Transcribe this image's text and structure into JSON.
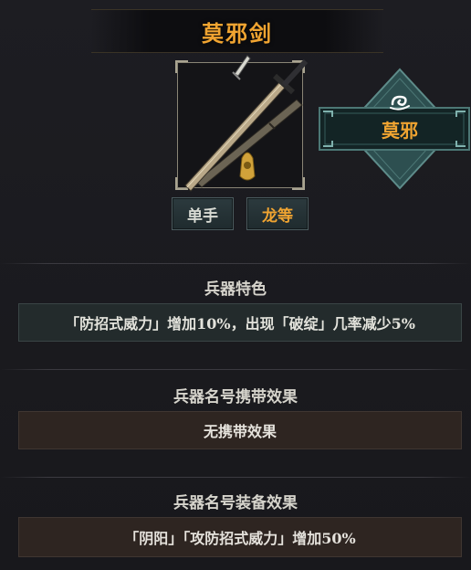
{
  "weapon": {
    "name": "莫邪剑",
    "hand_type": "单手",
    "grade": "龙等",
    "badge_name": "莫邪"
  },
  "sections": {
    "feature": {
      "title": "兵器特色",
      "text": "「防招式威力」增加10%，出现「破绽」几率减少5%"
    },
    "carry": {
      "title": "兵器名号携带效果",
      "text": "无携带效果"
    },
    "equip": {
      "title": "兵器名号装备效果",
      "text": "「阴阳」「攻防招式威力」增加50%"
    }
  },
  "colors": {
    "accent_orange": "#f0a431",
    "teal_panel": "#232b2c",
    "brown_panel": "#2e2521",
    "badge_teal": "#3f6b6a"
  },
  "icons": {
    "weapon": "sword-with-sheath-icon",
    "badge": "swirl-cloud-icon"
  }
}
